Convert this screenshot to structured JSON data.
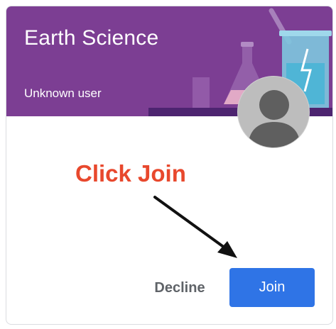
{
  "card": {
    "title": "Earth Science",
    "subtitle": "Unknown user",
    "banner_color": "#7c3e93",
    "banner_art": "science-flasks-illustration"
  },
  "avatar": {
    "icon": "person-icon"
  },
  "annotation": {
    "text": "Click Join",
    "color": "#e8482d",
    "arrow": "arrow-pointing-to-join"
  },
  "actions": {
    "decline_label": "Decline",
    "join_label": "Join",
    "join_color": "#2f74e6"
  }
}
